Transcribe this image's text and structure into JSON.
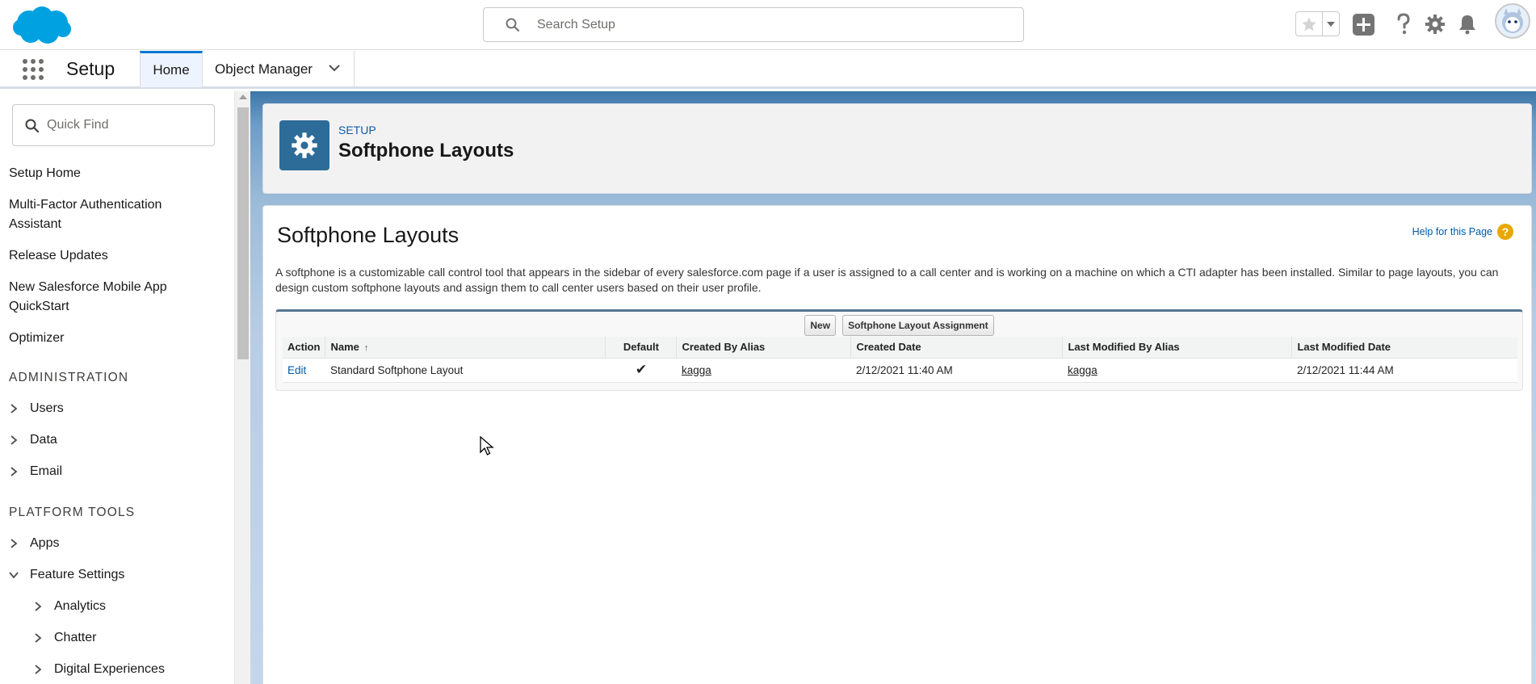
{
  "header": {
    "search_placeholder": "Search Setup",
    "icons": [
      "salesforce-cloud-logo",
      "search-icon",
      "star-icon",
      "chevron-down-icon",
      "plus-icon",
      "help-icon",
      "gear-icon",
      "bell-icon",
      "avatar"
    ]
  },
  "nav": {
    "app_name": "Setup",
    "tabs": [
      {
        "label": "Home",
        "active": true
      },
      {
        "label": "Object Manager",
        "dropdown": true
      }
    ]
  },
  "sidebar": {
    "quick_find_placeholder": "Quick Find",
    "items": [
      {
        "label": "Setup Home"
      },
      {
        "label": "Multi-Factor Authentication Assistant"
      },
      {
        "label": "Release Updates"
      },
      {
        "label": "New Salesforce Mobile App QuickStart"
      },
      {
        "label": "Optimizer"
      }
    ],
    "section_admin": "ADMINISTRATION",
    "admin_items": [
      "Users",
      "Data",
      "Email"
    ],
    "section_platform": "PLATFORM TOOLS",
    "platform_items": [
      "Apps",
      "Feature Settings"
    ],
    "feature_children": [
      "Analytics",
      "Chatter",
      "Digital Experiences"
    ]
  },
  "page_header": {
    "breadcrumb": "SETUP",
    "title": "Softphone Layouts"
  },
  "content": {
    "title": "Softphone Layouts",
    "help_link": "Help for this Page",
    "description": "A softphone is a customizable call control tool that appears in the sidebar of every salesforce.com page if a user is assigned to a call center and is working on a machine on which a CTI adapter has been installed. Similar to page layouts, you can design custom softphone layouts and assign them to call center users based on their user profile.",
    "buttons": {
      "new": "New",
      "assignment": "Softphone Layout Assignment"
    },
    "table": {
      "columns": [
        "Action",
        "Name",
        "Default",
        "Created By Alias",
        "Created Date",
        "Last Modified By Alias",
        "Last Modified Date"
      ],
      "rows": [
        {
          "action": "Edit",
          "name": "Standard Softphone Layout",
          "default": "✔",
          "created_by": "kagga",
          "created_date": "2/12/2021 11:40 AM",
          "modified_by": "kagga",
          "modified_date": "2/12/2021 11:44 AM"
        }
      ]
    }
  },
  "colors": {
    "brand_blue": "#0176d3",
    "setup_tile": "#2d6b98",
    "link": "#015ba7"
  }
}
